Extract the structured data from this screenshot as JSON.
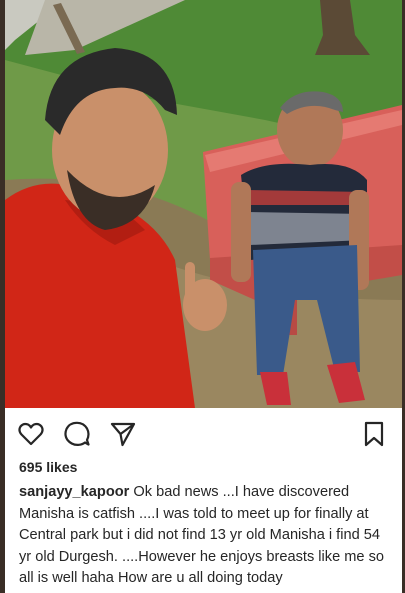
{
  "post": {
    "likes": "695 likes",
    "username": "sanjayy_kapoor",
    "caption": "Ok bad news ...I have discovered Manisha is catfish ....I was told to meet up for finally at Central park but i did not find 13 yr old Manisha i find 54 yr old Durgesh. ....However he enjoys breasts like me so all is well haha How are u all doing today"
  },
  "actions": {
    "icons": [
      "heart-icon",
      "comment-icon",
      "share-icon",
      "bookmark-icon"
    ]
  },
  "colors": {
    "text": "#262626",
    "bench": "#d8605a",
    "shirt_red": "#d12617",
    "grass": "#5a8a3c"
  }
}
